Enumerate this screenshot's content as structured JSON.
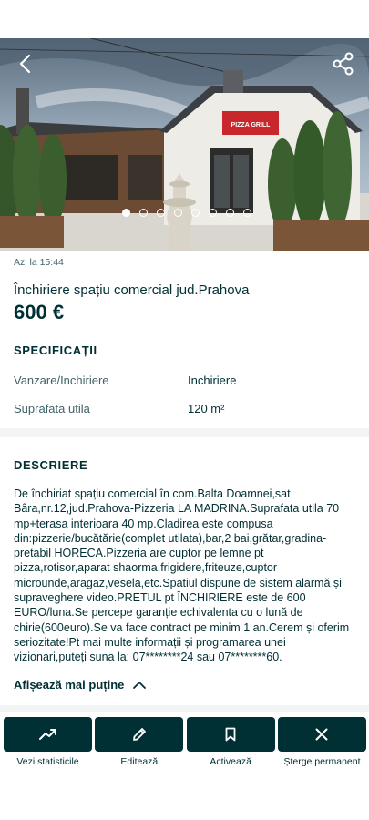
{
  "hero": {
    "image_alt": "Pizzeria building photo",
    "sign_text": "PIZZA GRILL",
    "dot_count": 8,
    "active_dot": 0
  },
  "listing": {
    "date": "Azi la 15:44",
    "title": "Închiriere spațiu comercial jud.Prahova",
    "price": "600 €"
  },
  "specs": {
    "heading": "SPECIFICAȚII",
    "rows": [
      {
        "label": "Vanzare/Inchiriere",
        "value": "Inchiriere"
      },
      {
        "label": "Suprafata utila",
        "value": "120 m²"
      }
    ]
  },
  "description": {
    "heading": "DESCRIERE",
    "text": "De închiriat spațiu comercial în com.Balta Doamnei,sat Bâra,nr.12,jud.Prahova-Pizzeria LA MADRINA.Suprafata utila 70 mp+terasa interioara 40 mp.Cladirea este compusa din:pizzerie/bucătărie(complet utilata),bar,2 bai,grătar,gradina-pretabil HORECA.Pizzeria are cuptor pe lemne pt pizza,rotisor,aparat shaorma,frigidere,friteuze,cuptor microunde,aragaz,vesela,etc.Spatiul dispune de sistem alarmă și supraveghere video.PRETUL pt ÎNCHIRIERE este de 600 EURO/luna.Se percepe garanție echivalenta cu o lună de chirie(600euro).Se va face contract pe minim 1 an.Cerem și oferim seriozitate!Pt mai multe informații și programarea unei vizionari,puteți suna la: 07********24 sau 07********60.",
    "toggle_label": "Afișează mai puține"
  },
  "actions": [
    {
      "label": "Vezi statisticile",
      "icon": "trending-up-icon"
    },
    {
      "label": "Editează",
      "icon": "pencil-icon"
    },
    {
      "label": "Activează",
      "icon": "bookmark-icon"
    },
    {
      "label": "Șterge permanent",
      "icon": "close-icon"
    }
  ],
  "colors": {
    "primary": "#002f34",
    "secondary_text": "#406367",
    "divider": "#f2f4f5",
    "sign_red": "#c8282b"
  }
}
